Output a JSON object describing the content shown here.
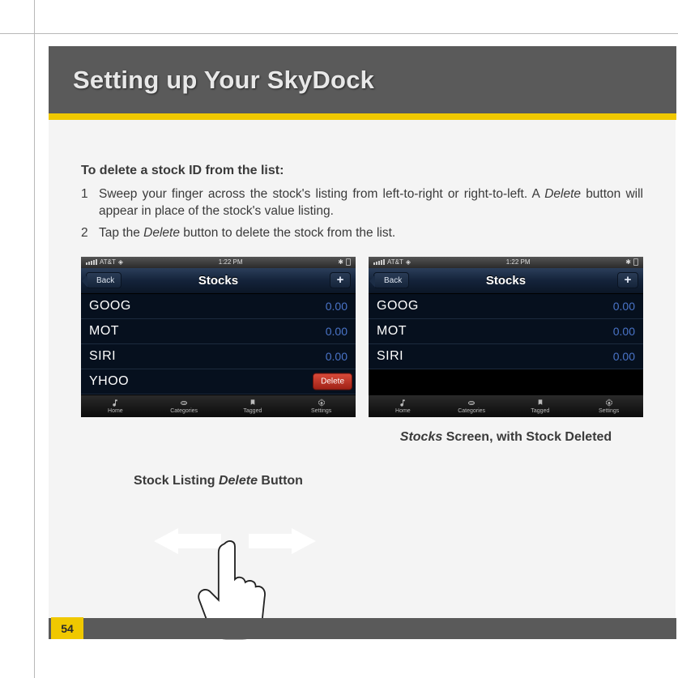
{
  "page": {
    "title": "Setting up Your SkyDock",
    "number": "54"
  },
  "section": {
    "heading": "To delete a stock ID from the list:",
    "steps": [
      {
        "num": "1",
        "parts": [
          "Sweep your finger across the stock's listing from left-to-right or right-to-left. A ",
          "Delete",
          " button will appear in place of the stock's value listing."
        ]
      },
      {
        "num": "2",
        "parts": [
          "Tap the ",
          "Delete",
          " button to delete the stock from the list."
        ]
      }
    ]
  },
  "captions": {
    "left_pre": "Stock Listing ",
    "left_em": "Delete",
    "left_post": " Button",
    "right_em": "Stocks",
    "right_post": " Screen, with Stock Deleted"
  },
  "phone_common": {
    "status_carrier": "AT&T",
    "status_time": "1:22 PM",
    "nav_title": "Stocks",
    "back_label": "Back",
    "plus_label": "+",
    "delete_label": "Delete",
    "tabs": [
      "Home",
      "Categories",
      "Tagged",
      "Settings"
    ]
  },
  "phone_left": {
    "rows": [
      {
        "sym": "GOOG",
        "val": "0.00"
      },
      {
        "sym": "MOT",
        "val": "0.00"
      },
      {
        "sym": "SIRI",
        "val": "0.00"
      },
      {
        "sym": "YHOO",
        "val": ""
      }
    ]
  },
  "phone_right": {
    "rows": [
      {
        "sym": "GOOG",
        "val": "0.00"
      },
      {
        "sym": "MOT",
        "val": "0.00"
      },
      {
        "sym": "SIRI",
        "val": "0.00"
      }
    ]
  }
}
